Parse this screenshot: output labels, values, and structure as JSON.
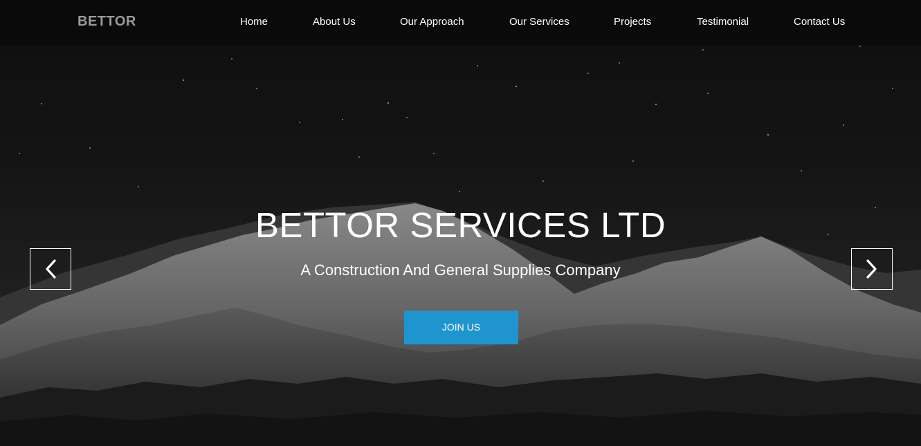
{
  "nav": {
    "brand": "BETTOR",
    "items": [
      {
        "label": "Home"
      },
      {
        "label": "About Us"
      },
      {
        "label": "Our Approach"
      },
      {
        "label": "Our Services"
      },
      {
        "label": "Projects"
      },
      {
        "label": "Testimonial"
      },
      {
        "label": "Contact Us"
      }
    ]
  },
  "hero": {
    "title": "BETTOR SERVICES LTD",
    "subtitle": "A Construction And General Supplies Company",
    "cta_label": "JOIN US",
    "prev_icon": "chevron-left-icon",
    "next_icon": "chevron-right-icon",
    "background": "snowy mountain range under starry night sky"
  },
  "colors": {
    "accent": "#1f95cf",
    "nav_background": "#0a0a0a",
    "brand_text": "#9a9a9a",
    "text": "#ffffff"
  }
}
